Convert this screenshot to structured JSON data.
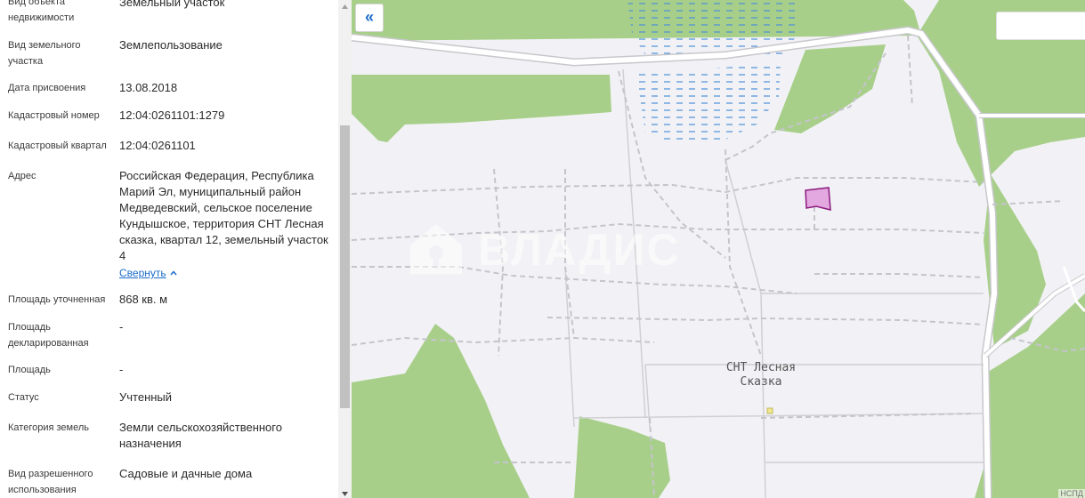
{
  "details": [
    {
      "label": "Вид объекта недвижимости",
      "value": "Земельный участок"
    },
    {
      "label": "Вид земельного участка",
      "value": "Землепользование"
    },
    {
      "label": "Дата присвоения",
      "value": "13.08.2018"
    },
    {
      "label": "Кадастровый номер",
      "value": "12:04:0261101:1279"
    },
    {
      "label": "Кадастровый квартал",
      "value": "12:04:0261101"
    },
    {
      "label": "Адрес",
      "value": "Российская Федерация, Республика Марий Эл, муниципальный район Медведевский, сельское поселение Кундышское, территория СНТ Лесная сказка, квартал 12, земельный участок 4"
    },
    {
      "label": "Площадь уточненная",
      "value": "868 кв. м"
    },
    {
      "label": "Площадь декларированная",
      "value": "-"
    },
    {
      "label": "Площадь",
      "value": "-"
    },
    {
      "label": "Статус",
      "value": "Учтенный"
    },
    {
      "label": "Категория земель",
      "value": "Земли сельскохозяйственного назначения"
    },
    {
      "label": "Вид разрешенного использования",
      "value": "Садовые и дачные дома"
    }
  ],
  "collapse_link": "Свернуть",
  "map": {
    "collapse_button": "«",
    "place_label": "СНТ Лесная Сказка",
    "watermark": "ВЛАДИС",
    "attribution": "НСПД",
    "colors": {
      "background": "#f2f2f6",
      "forest": "#a8cf8a",
      "parcel_fill": "#e4a8e0",
      "parcel_stroke": "#8b1a7e",
      "water": "#4a8fd8",
      "road": "#ffffff"
    }
  }
}
